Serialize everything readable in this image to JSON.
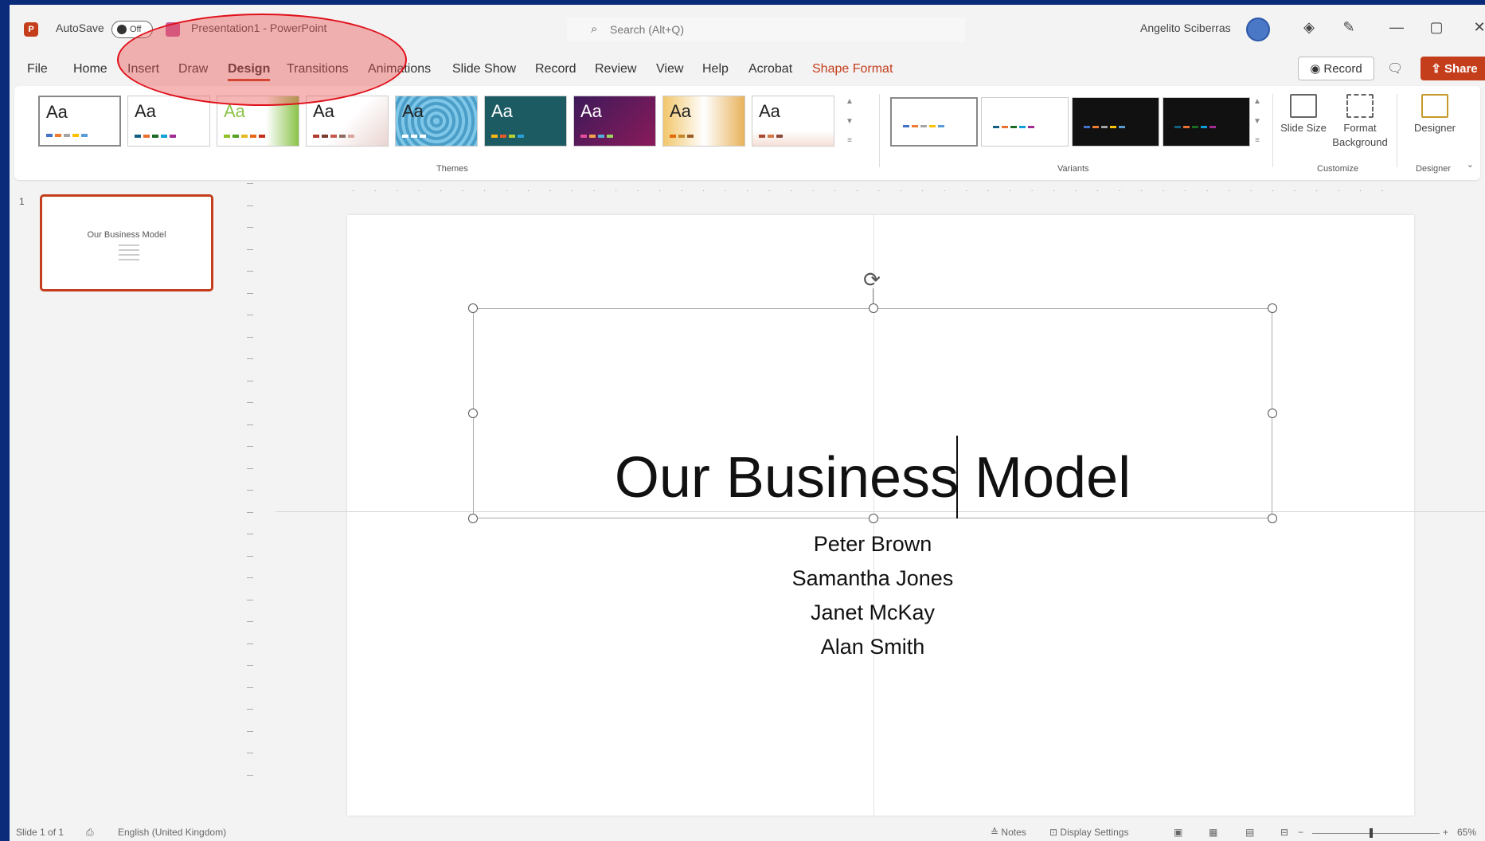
{
  "titlebar": {
    "app_icon_letter": "P",
    "autosave_label": "AutoSave",
    "autosave_state": "Off",
    "document_title": "Presentation1 - PowerPoint",
    "search_placeholder": "Search (Alt+Q)",
    "user_name": "Angelito Sciberras",
    "minimize": "—",
    "restore": "▢",
    "close": "✕"
  },
  "tabs": [
    "File",
    "Home",
    "Insert",
    "Draw",
    "Design",
    "Transitions",
    "Animations",
    "Slide Show",
    "Record",
    "Review",
    "View",
    "Help",
    "Acrobat",
    "Shape Format"
  ],
  "active_tab": "Design",
  "ribbon_actions": {
    "record_label": "Record",
    "share_label": "Share"
  },
  "themes": {
    "group_label": "Themes",
    "items": [
      "Aa",
      "Aa",
      "Aa",
      "Aa",
      "Aa",
      "Aa",
      "Aa",
      "Aa",
      "Aa"
    ]
  },
  "variants": {
    "group_label": "Variants"
  },
  "customize": {
    "group_label": "Customize",
    "slide_size_label": "Slide Size",
    "format_background_label": "Format Background"
  },
  "designer": {
    "group_label": "Designer",
    "button_label": "Designer"
  },
  "thumbnail": {
    "number": "1",
    "title": "Our Business Model"
  },
  "slide": {
    "title": "Our Business Model",
    "subtitle_lines": [
      "Peter Brown",
      "Samantha Jones",
      "Janet McKay",
      "Alan Smith"
    ]
  },
  "statusbar": {
    "slide_count": "Slide 1 of 1",
    "language": "English (United Kingdom)",
    "notes_label": "Notes",
    "display_settings_label": "Display Settings",
    "zoom_level": "65%"
  },
  "colors": {
    "accent": "#c43e1c",
    "background": "#0a2a7a",
    "annotation": "#e0101a"
  }
}
